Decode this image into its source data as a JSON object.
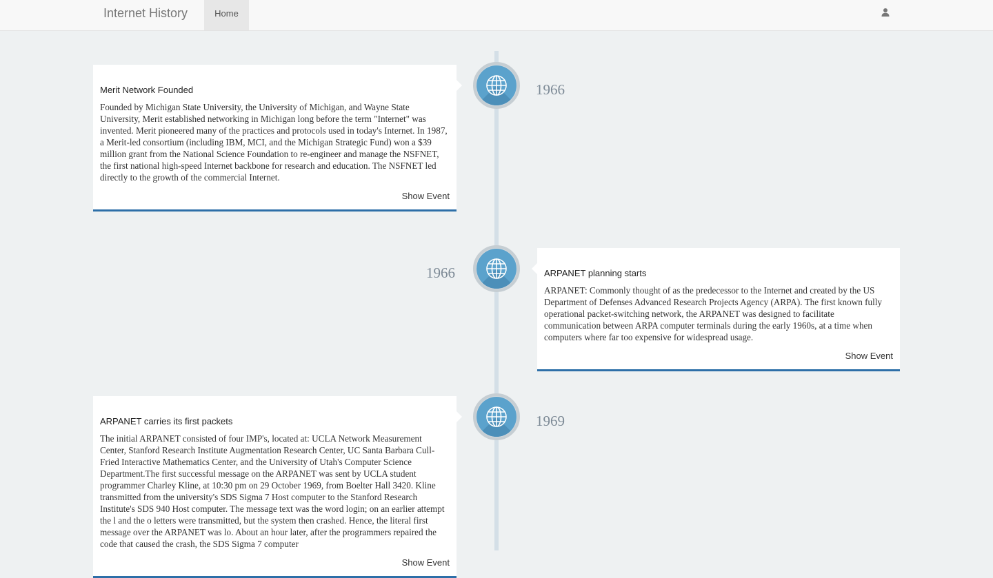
{
  "nav": {
    "brand": "Internet History",
    "home_label": "Home",
    "user_icon": "user-icon"
  },
  "events": [
    {
      "year": "1966",
      "title": "Merit Network Founded",
      "body": "Founded by Michigan State University, the University of Michigan, and Wayne State University, Merit established networking in Michigan long before the term \"Internet\" was invented. Merit pioneered many of the practices and protocols used in today's Internet. In 1987, a Merit-led consortium (including IBM, MCI, and the Michigan Strategic Fund) won a $39 million grant from the National Science Foundation to re-engineer and manage the NSFNET, the first national high-speed Internet backbone for research and education. The NSFNET led directly to the growth of the commercial Internet.",
      "action": "Show Event",
      "icon": "globe-icon"
    },
    {
      "year": "1966",
      "title": "ARPANET planning starts",
      "body": "ARPANET: Commonly thought of as the predecessor to the Internet and created by the US Department of Defenses Advanced Research Projects Agency (ARPA). The first known fully operational packet-switching network, the ARPANET was designed to facilitate communication between ARPA computer terminals during the early 1960s, at a time when computers where far too expensive for widespread usage.",
      "action": "Show Event",
      "icon": "globe-icon"
    },
    {
      "year": "1969",
      "title": "ARPANET carries its first packets",
      "body": "The initial ARPANET consisted of four IMP's, located at: UCLA Network Measurement Center, Stanford Research Institute Augmentation Research Center, UC Santa Barbara Cull-Fried Interactive Mathematics Center, and the University of Utah's Computer Science Department.The first successful message on the ARPANET was sent by UCLA student programmer Charley Kline, at 10:30 pm on 29 October 1969, from Boelter Hall 3420. Kline transmitted from the university's SDS Sigma 7 Host computer to the Stanford Research Institute's SDS 940 Host computer. The message text was the word login; on an earlier attempt the l and the o letters were transmitted, but the system then crashed. Hence, the literal first message over the ARPANET was lo. About an hour later, after the programmers repaired the code that caused the crash, the SDS Sigma 7 computer",
      "action": "Show Event",
      "icon": "globe-icon"
    }
  ]
}
